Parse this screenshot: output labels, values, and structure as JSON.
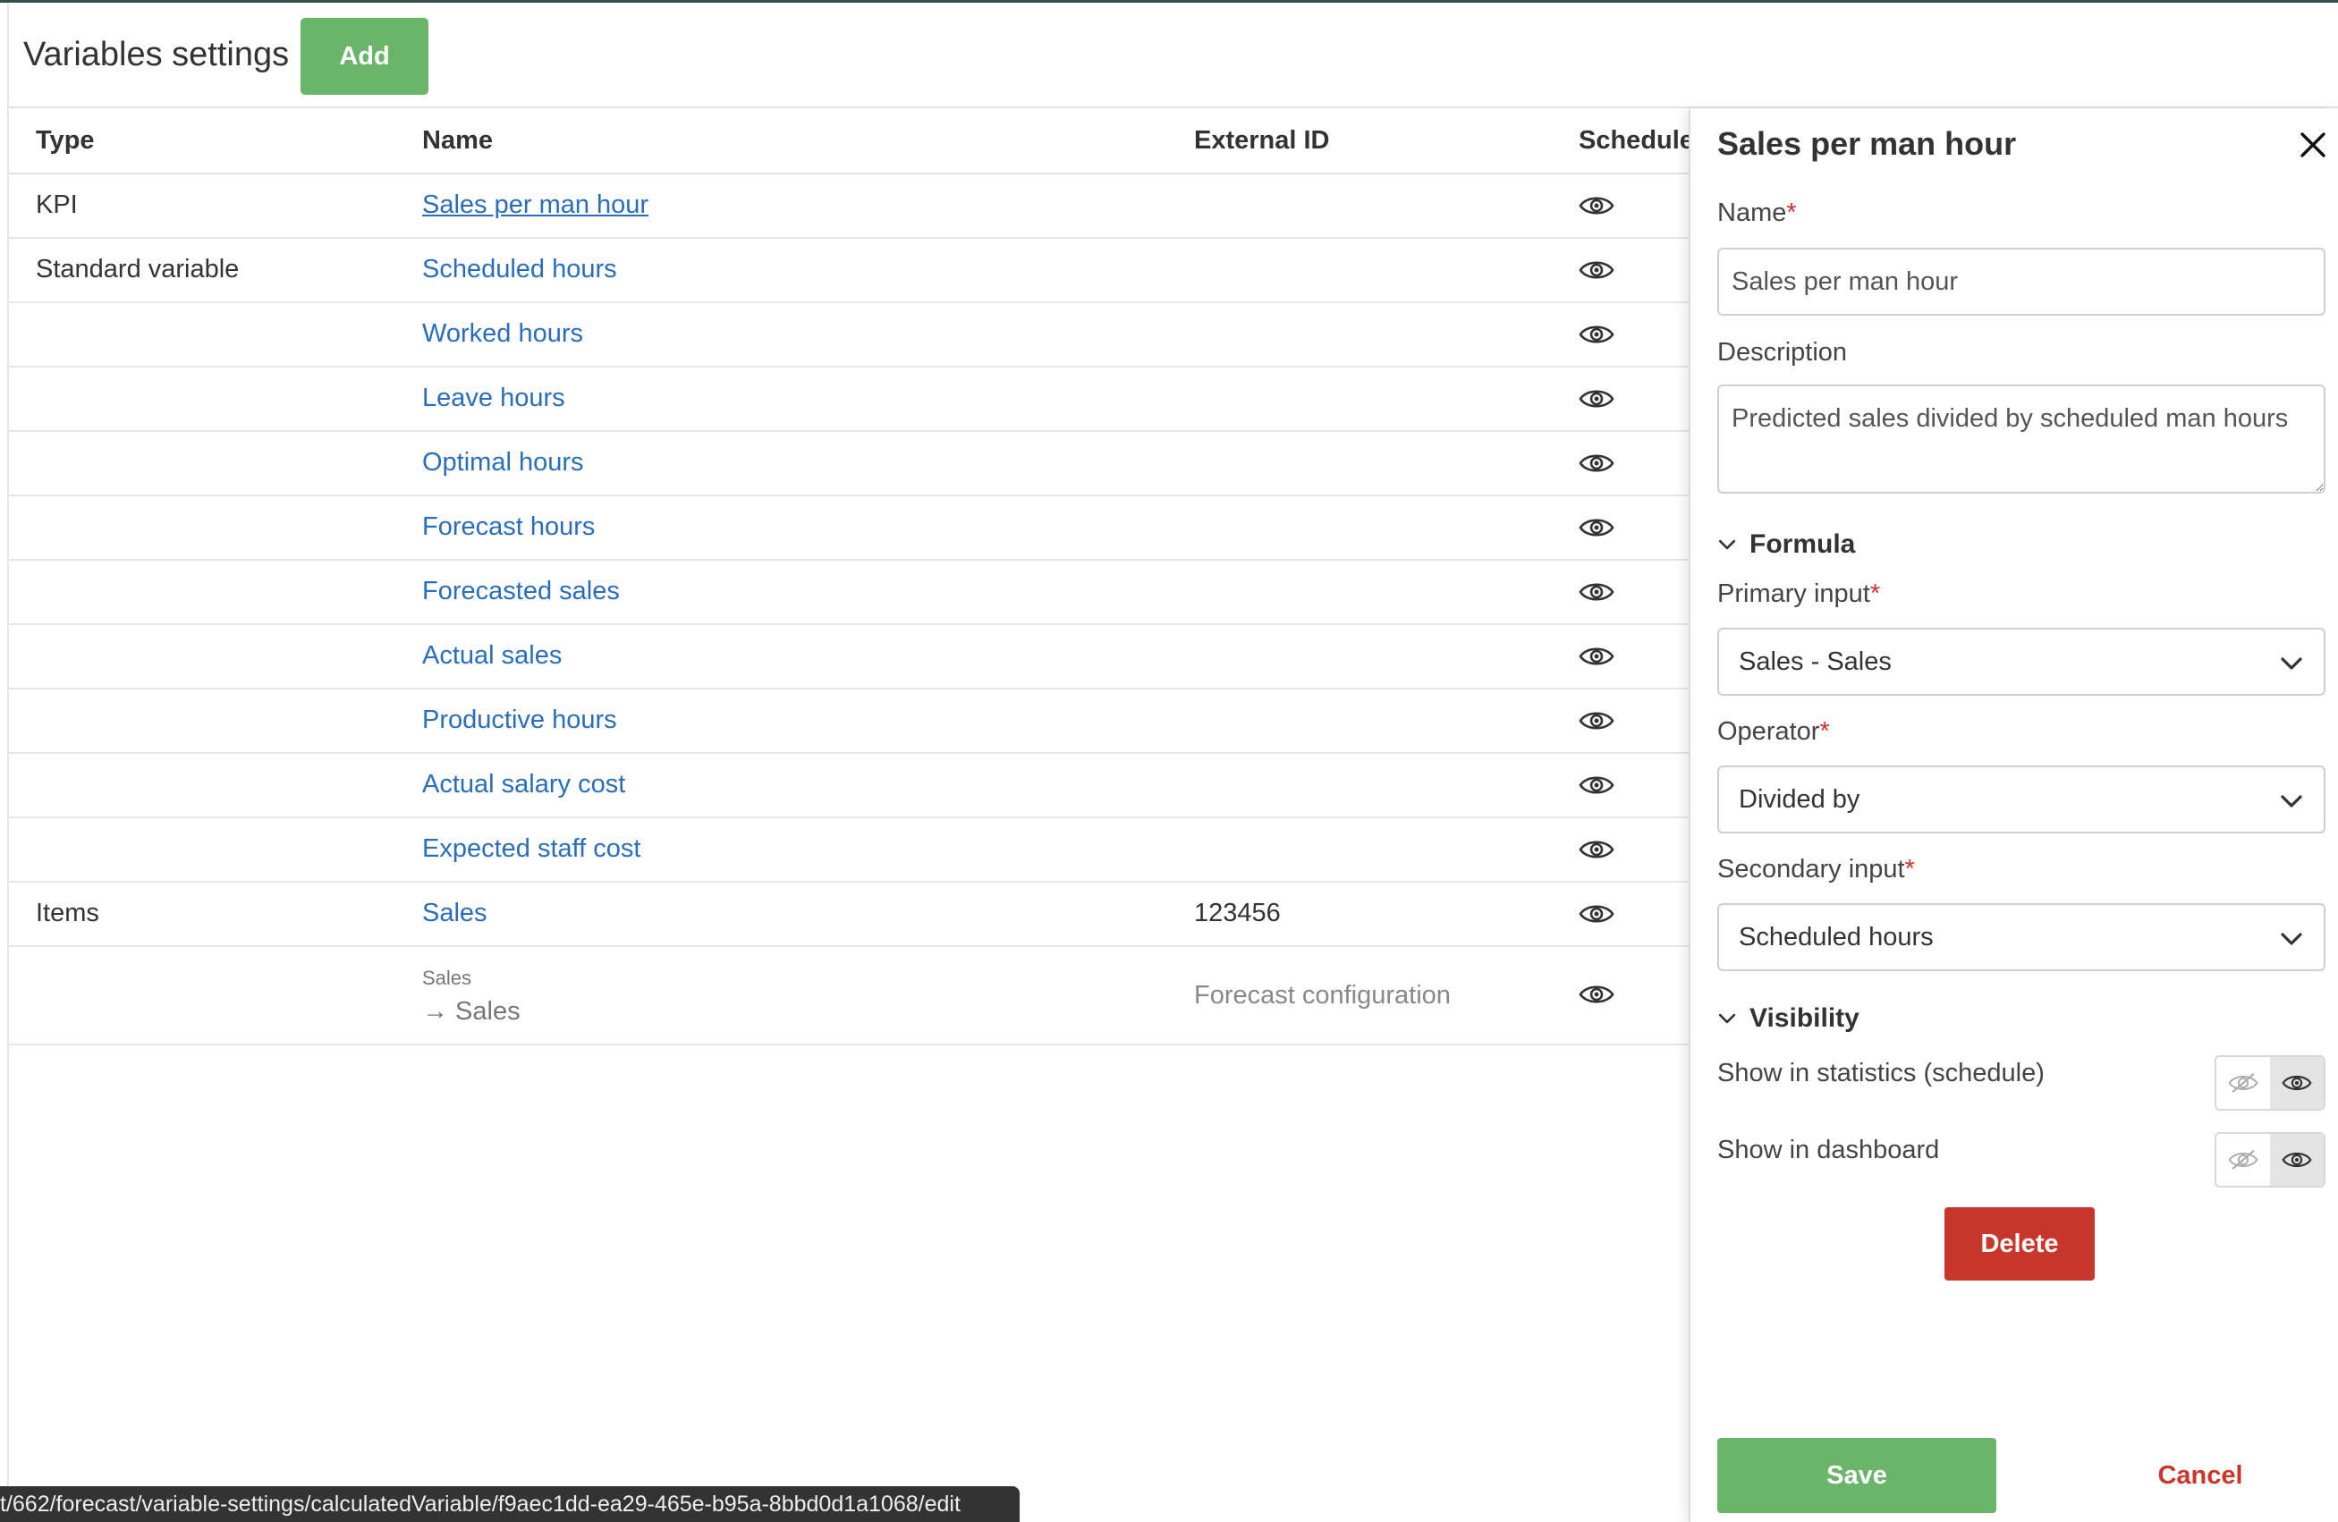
{
  "page": {
    "title": "Variables settings",
    "add_label": "Add"
  },
  "table": {
    "headers": {
      "type": "Type",
      "name": "Name",
      "external_id": "External ID",
      "schedule": "Schedule"
    },
    "rows": [
      {
        "type": "KPI",
        "name": "Sales per man hour",
        "external_id": ""
      },
      {
        "type": "Standard variable",
        "name": "Scheduled hours",
        "external_id": ""
      },
      {
        "type": "",
        "name": "Worked hours",
        "external_id": ""
      },
      {
        "type": "",
        "name": "Leave hours",
        "external_id": ""
      },
      {
        "type": "",
        "name": "Optimal hours",
        "external_id": ""
      },
      {
        "type": "",
        "name": "Forecast hours",
        "external_id": ""
      },
      {
        "type": "",
        "name": "Forecasted sales",
        "external_id": ""
      },
      {
        "type": "",
        "name": "Actual sales",
        "external_id": ""
      },
      {
        "type": "",
        "name": "Productive hours",
        "external_id": ""
      },
      {
        "type": "",
        "name": "Actual salary cost",
        "external_id": ""
      },
      {
        "type": "",
        "name": "Expected staff cost",
        "external_id": ""
      },
      {
        "type": "Items",
        "name": "Sales",
        "external_id": "123456"
      }
    ],
    "sub_row": {
      "label": "Sales",
      "target": "→ Sales",
      "external_id": "Forecast configuration"
    }
  },
  "status_bar": {
    "url": "t/662/forecast/variable-settings/calculatedVariable/f9aec1dd-ea29-465e-b95a-8bbd0d1a1068/edit"
  },
  "panel": {
    "title": "Sales per man hour",
    "name_label": "Name",
    "name_value": "Sales per man hour",
    "description_label": "Description",
    "description_value": "Predicted sales divided by scheduled man hours",
    "formula_label": "Formula",
    "primary_input_label": "Primary input",
    "primary_input_value": "Sales - Sales",
    "operator_label": "Operator",
    "operator_value": "Divided by",
    "secondary_input_label": "Secondary input",
    "secondary_input_value": "Scheduled hours",
    "visibility_label": "Visibility",
    "show_statistics_label": "Show in statistics (schedule)",
    "show_dashboard_label": "Show in dashboard",
    "delete_label": "Delete",
    "save_label": "Save",
    "cancel_label": "Cancel",
    "required_mark": "*"
  },
  "colors": {
    "accent_green": "#6bb56b",
    "link_blue": "#2a6ebb",
    "danger_red": "#c9372c"
  }
}
